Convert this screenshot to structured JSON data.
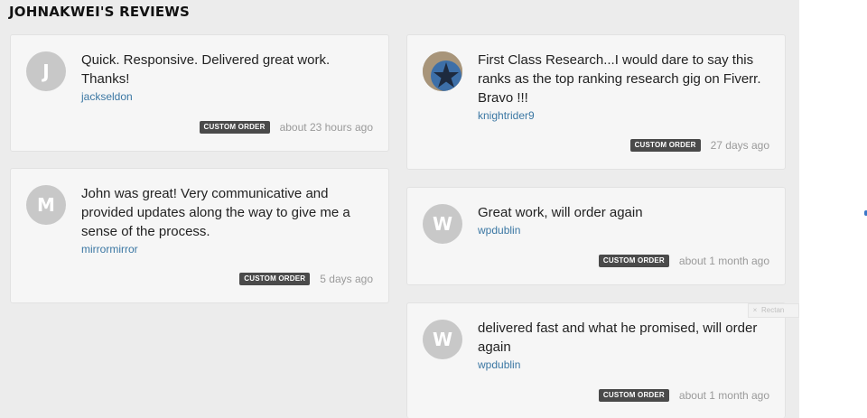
{
  "page": {
    "title": "JOHNAKWEI'S REVIEWS"
  },
  "reviews": [
    {
      "initial": "J",
      "text": "Quick. Responsive. Delivered great work. Thanks!",
      "reviewer": "jackseldon",
      "badge": "CUSTOM ORDER",
      "time": "about 23 hours ago"
    },
    {
      "initial": "M",
      "text": "John was great! Very communicative and provided updates along the way to give me a sense of the process.",
      "reviewer": "mirrormirror",
      "badge": "CUSTOM ORDER",
      "time": "5 days ago"
    },
    {
      "initial": "",
      "text": "First Class Research...I would dare to say this ranks as the top ranking research gig on Fiverr. Bravo !!!",
      "reviewer": "knightrider9",
      "badge": "CUSTOM ORDER",
      "time": "27 days ago"
    },
    {
      "initial": "W",
      "text": "Great work, will order again",
      "reviewer": "wpdublin",
      "badge": "CUSTOM ORDER",
      "time": "about 1 month ago"
    },
    {
      "initial": "W",
      "text": "delivered fast and what he promised, will order again",
      "reviewer": "wpdublin",
      "badge": "CUSTOM ORDER",
      "time": "about 1 month ago"
    }
  ],
  "overlay": {
    "close": "×",
    "label": "Rectan"
  },
  "colors": {
    "background": "#ececec",
    "card": "#f6f6f6",
    "link": "#3b77a3",
    "badge": "#4a4a4a",
    "avatar": "#c8c8c8"
  }
}
